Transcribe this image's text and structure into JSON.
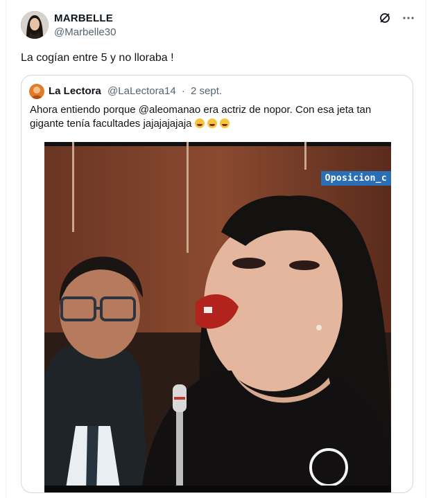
{
  "post": {
    "author_name": "MARBELLE",
    "author_handle": "@Marbelle30",
    "text": "La cogían entre 5 y no lloraba !"
  },
  "top_icons": [
    "grok-icon",
    "more-icon"
  ],
  "quote": {
    "author_name": "La Lectora",
    "author_handle": "@LaLectora14",
    "separator": "·",
    "date": "2 sept.",
    "text": "Ahora entiendo porque @aleomanao era actriz de nopor. Con esa jeta tan gigante tenía facultades jajajajajaja",
    "emoji_count": 3,
    "media_overlay_text": "Oposicion_c"
  },
  "colors": {
    "text_primary": "#0f1419",
    "text_secondary": "#536471",
    "border": "#cfd9de",
    "overlay_blue": "#2a6fb5"
  }
}
